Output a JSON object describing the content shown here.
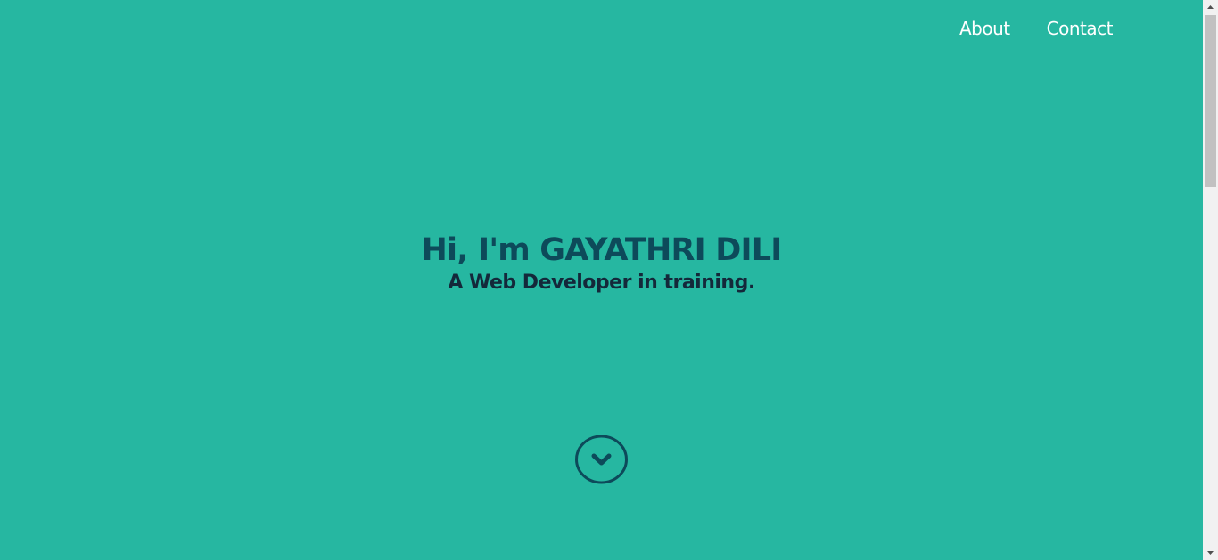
{
  "nav": {
    "items": [
      {
        "label": "About"
      },
      {
        "label": "Contact"
      }
    ]
  },
  "hero": {
    "title": "Hi, I'm GAYATHRI DILI",
    "subtitle": "A Web Developer in training."
  },
  "scroll_down": {
    "icon": "chevron-down-circle-icon"
  },
  "colors": {
    "background": "#26b7a1",
    "title": "#0d4a5a",
    "subtitle": "#14283a",
    "nav_text": "#ffffff"
  }
}
